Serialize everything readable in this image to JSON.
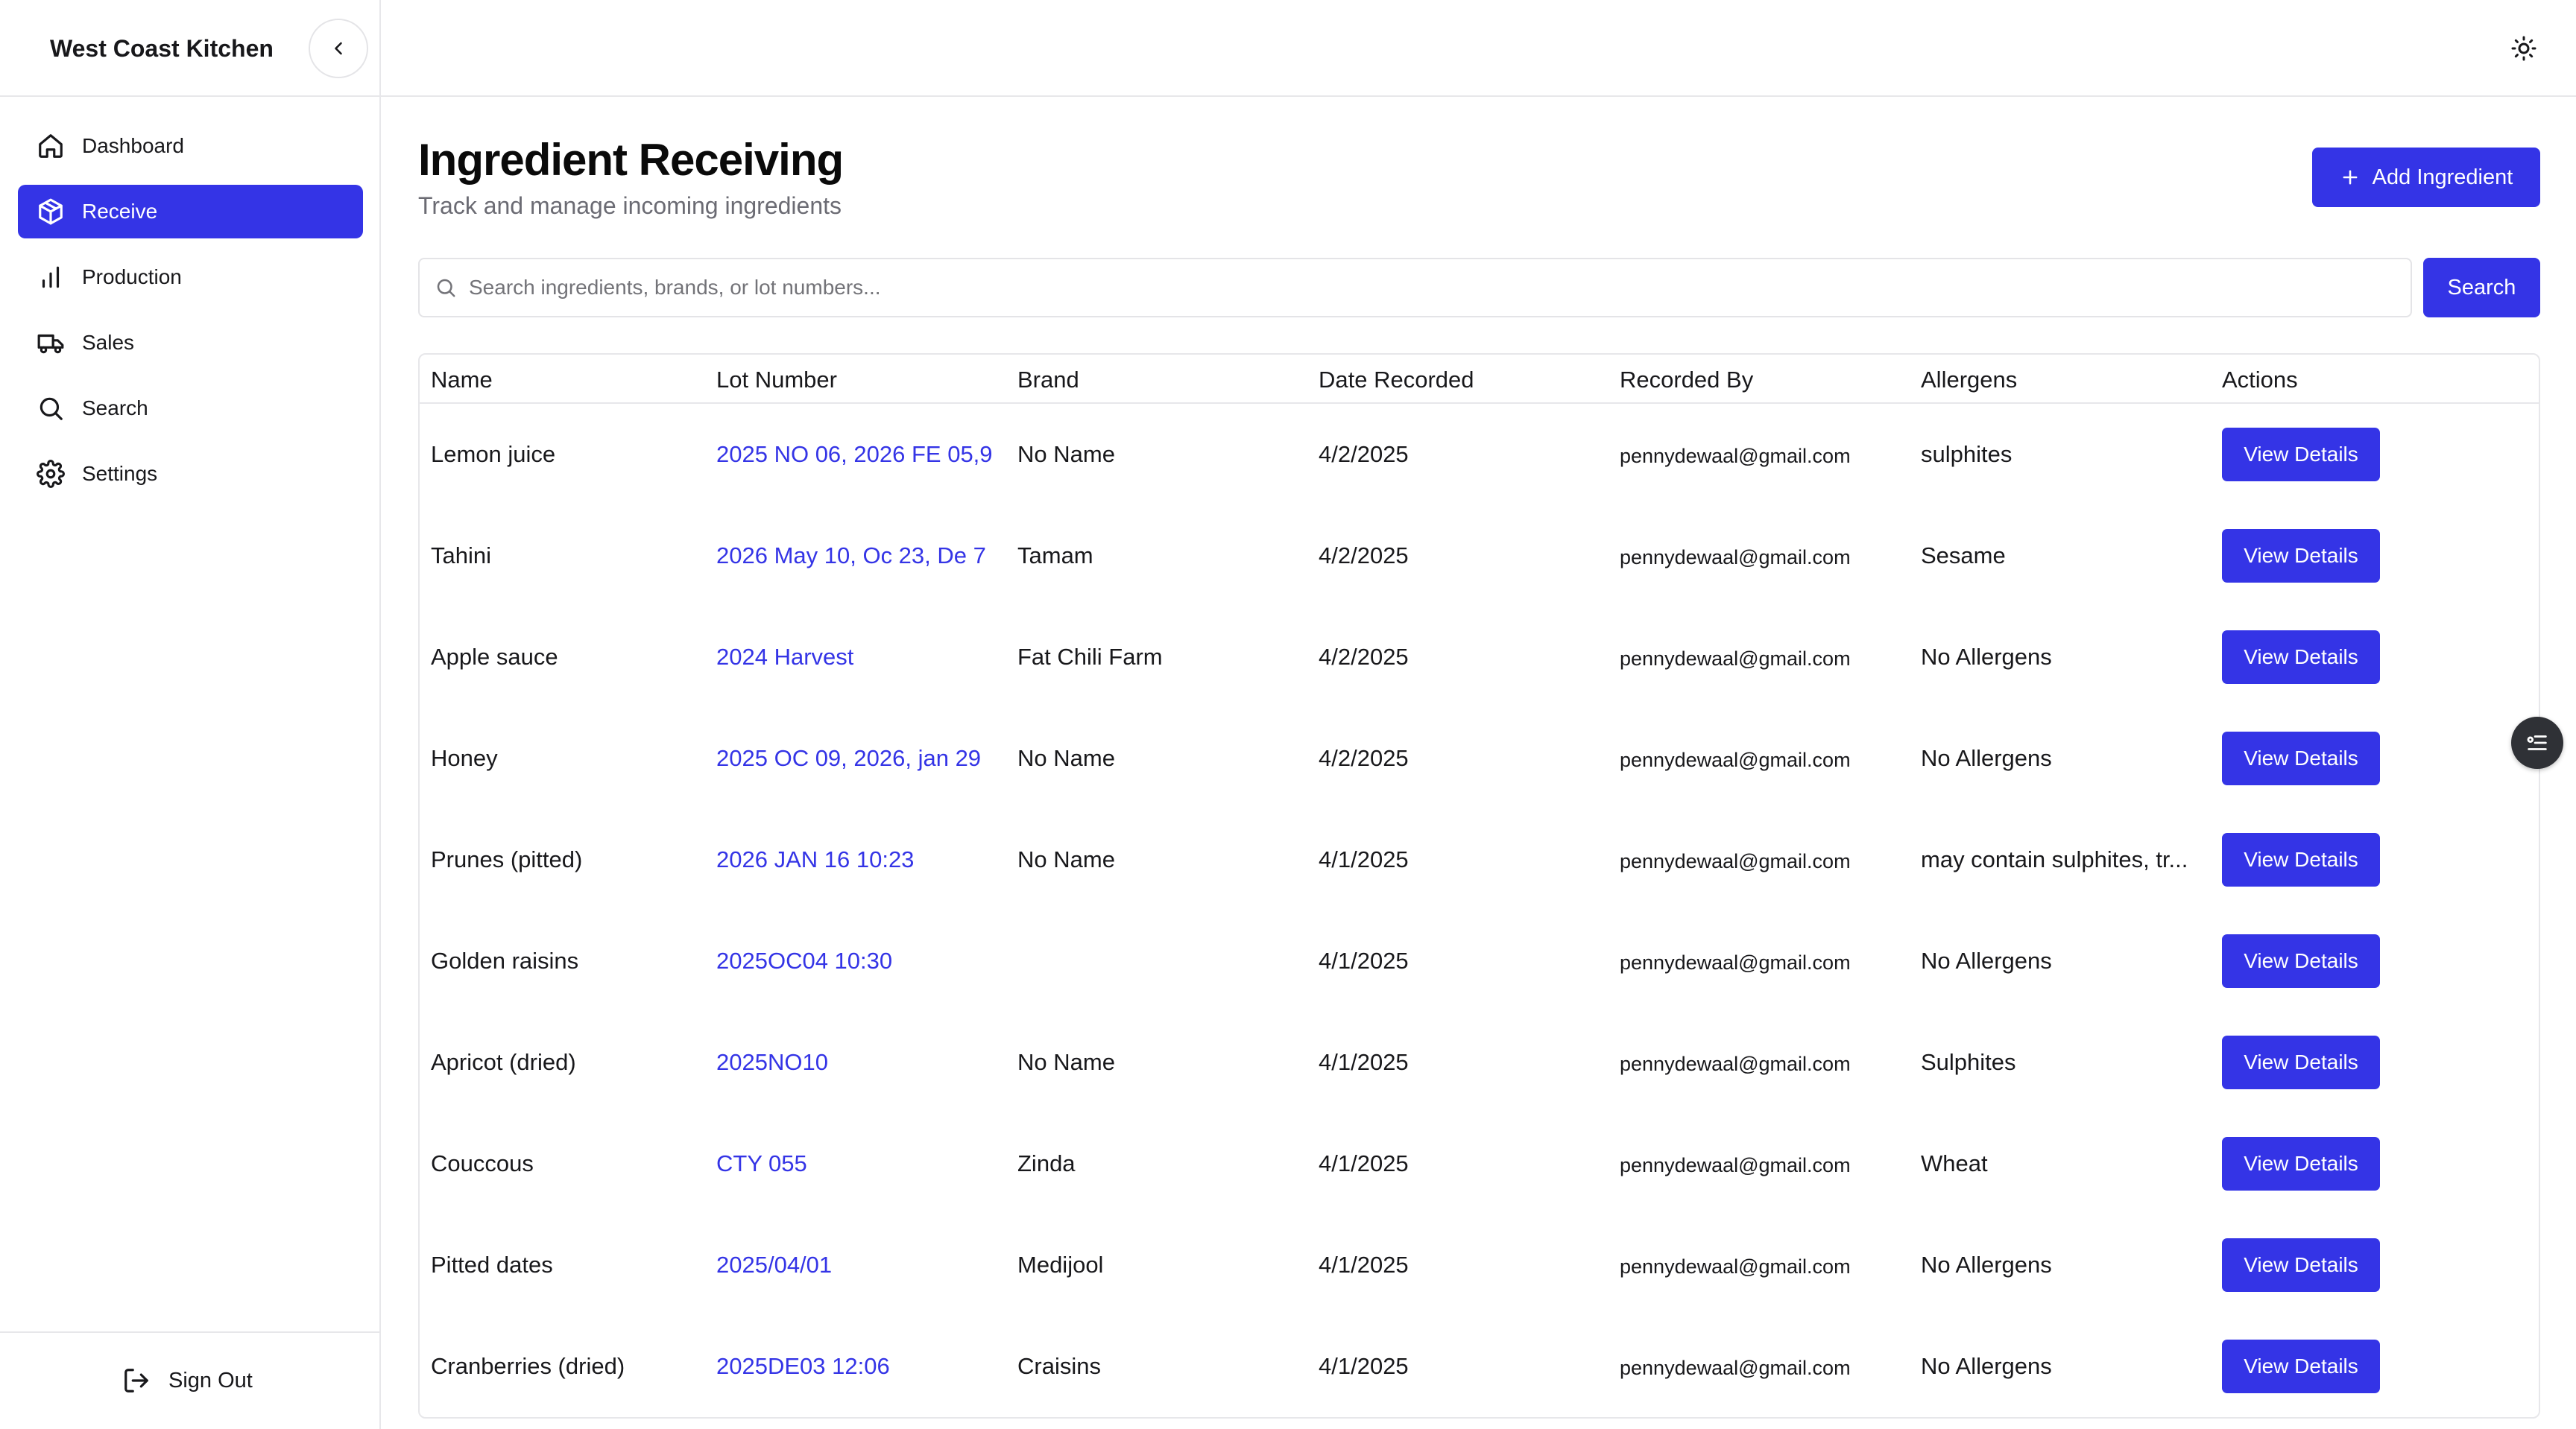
{
  "sidebar": {
    "brand": "West Coast Kitchen",
    "items": [
      {
        "label": "Dashboard",
        "icon": "home-icon",
        "active": false
      },
      {
        "label": "Receive",
        "icon": "package-icon",
        "active": true
      },
      {
        "label": "Production",
        "icon": "bar-chart-icon",
        "active": false
      },
      {
        "label": "Sales",
        "icon": "truck-icon",
        "active": false
      },
      {
        "label": "Search",
        "icon": "search-icon",
        "active": false
      },
      {
        "label": "Settings",
        "icon": "gear-icon",
        "active": false
      }
    ],
    "sign_out": "Sign Out"
  },
  "header": {
    "title": "Ingredient Receiving",
    "subtitle": "Track and manage incoming ingredients",
    "add_button": "Add Ingredient"
  },
  "search": {
    "placeholder": "Search ingredients, brands, or lot numbers...",
    "value": "",
    "button": "Search"
  },
  "table": {
    "columns": [
      "Name",
      "Lot Number",
      "Brand",
      "Date Recorded",
      "Recorded By",
      "Allergens",
      "Actions"
    ],
    "action_label": "View Details",
    "rows": [
      {
        "name": "Lemon juice",
        "lot": "2025 NO 06, 2026 FE 05,9",
        "brand": "No Name",
        "date": "4/2/2025",
        "by": "pennydewaal@gmail.com",
        "allergens": "sulphites"
      },
      {
        "name": "Tahini",
        "lot": "2026 May 10, Oc 23, De 7",
        "brand": "Tamam",
        "date": "4/2/2025",
        "by": "pennydewaal@gmail.com",
        "allergens": "Sesame"
      },
      {
        "name": "Apple sauce",
        "lot": "2024 Harvest",
        "brand": "Fat Chili Farm",
        "date": "4/2/2025",
        "by": "pennydewaal@gmail.com",
        "allergens": "No Allergens"
      },
      {
        "name": "Honey",
        "lot": "2025 OC 09, 2026, jan 29",
        "brand": "No Name",
        "date": "4/2/2025",
        "by": "pennydewaal@gmail.com",
        "allergens": "No Allergens"
      },
      {
        "name": "Prunes (pitted)",
        "lot": "2026 JAN 16 10:23",
        "brand": "No Name",
        "date": "4/1/2025",
        "by": "pennydewaal@gmail.com",
        "allergens": "may contain sulphites, tr..."
      },
      {
        "name": "Golden raisins",
        "lot": "2025OC04 10:30",
        "brand": "",
        "date": "4/1/2025",
        "by": "pennydewaal@gmail.com",
        "allergens": "No Allergens"
      },
      {
        "name": "Apricot (dried)",
        "lot": "2025NO10",
        "brand": "No Name",
        "date": "4/1/2025",
        "by": "pennydewaal@gmail.com",
        "allergens": "Sulphites"
      },
      {
        "name": "Couccous",
        "lot": "CTY 055",
        "brand": "Zinda",
        "date": "4/1/2025",
        "by": "pennydewaal@gmail.com",
        "allergens": "Wheat"
      },
      {
        "name": "Pitted dates",
        "lot": "2025/04/01",
        "brand": "Medijool",
        "date": "4/1/2025",
        "by": "pennydewaal@gmail.com",
        "allergens": "No Allergens"
      },
      {
        "name": "Cranberries (dried)",
        "lot": "2025DE03 12:06",
        "brand": "Craisins",
        "date": "4/1/2025",
        "by": "pennydewaal@gmail.com",
        "allergens": "No Allergens"
      }
    ]
  },
  "colors": {
    "accent": "#3434e6",
    "border": "#e7e7ea",
    "muted_text": "#6b6b73"
  }
}
